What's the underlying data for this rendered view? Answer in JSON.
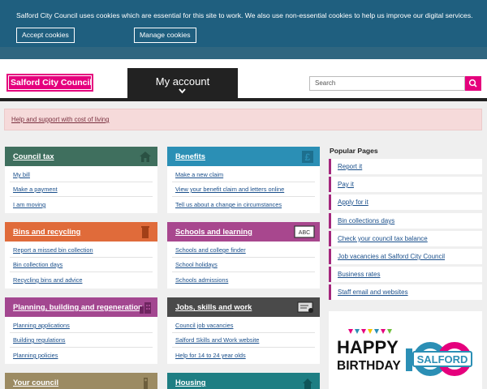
{
  "cookie_banner": {
    "message": "Salford City Council uses cookies which are essential for this site to work. We also use non-essential cookies to help us improve our digital services.",
    "accept_label": "Accept cookies",
    "manage_label": "Manage cookies"
  },
  "header": {
    "logo_text": "Salford City Council",
    "my_account_label": "My account",
    "search_placeholder": "Search"
  },
  "alert": {
    "link_text": "Help and support with cost of living"
  },
  "cards": [
    {
      "title": "Council tax",
      "color": "#3f6f5e",
      "icon": "house-icon",
      "links": [
        "My bill",
        "Make a payment",
        "I am moving"
      ]
    },
    {
      "title": "Benefits",
      "color": "#2b8fb5",
      "icon": "pound-icon",
      "links": [
        "Make a new claim",
        "View your benefit claim and letters online",
        "Tell us about a change in circumstances"
      ]
    },
    {
      "title": "Bins and recycling",
      "color": "#e06b3a",
      "icon": "bin-icon",
      "links": [
        "Report a missed bin collection",
        "Bin collection days",
        "Recycling bins and advice"
      ]
    },
    {
      "title": "Schools and learning",
      "color": "#a8478e",
      "icon": "blackboard-icon",
      "links": [
        "Schools and college finder",
        "School holidays",
        "Schools admissions"
      ]
    },
    {
      "title": "Planning, building and regeneration",
      "color": "#a34790",
      "icon": "buildings-icon",
      "links": [
        "Planning applications",
        "Building regulations",
        "Planning policies"
      ]
    },
    {
      "title": "Jobs, skills and work",
      "color": "#4a4a4a",
      "icon": "certificate-icon",
      "links": [
        "Council job vacancies",
        "Salford Skills and Work website",
        "Help for 14 to 24 year olds"
      ]
    },
    {
      "title": "Your council",
      "color": "#9c8b63",
      "icon": "tower-icon",
      "links": []
    },
    {
      "title": "Housing",
      "color": "#1e7e83",
      "icon": "home-icon",
      "links": []
    }
  ],
  "popular": {
    "title": "Popular Pages",
    "items": [
      "Report it",
      "Pay it",
      "Apply for it",
      "Bin collections days",
      "Check your council tax balance",
      "Job vacancies at Salford City Council",
      "Business rates",
      "Staff email and websites"
    ]
  },
  "birthday": {
    "line1": "HAPPY",
    "line2": "BIRTHDAY",
    "badge": "SALFORD"
  }
}
